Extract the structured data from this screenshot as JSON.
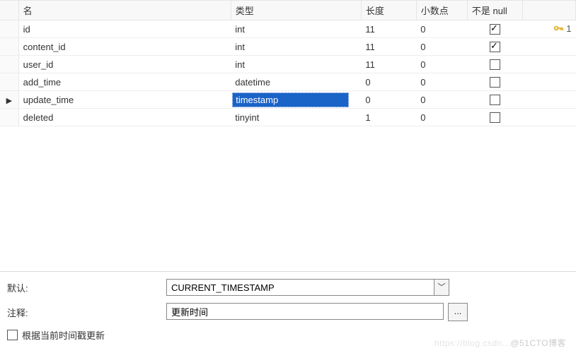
{
  "columns": {
    "name": "名",
    "type": "类型",
    "length": "长度",
    "decimals": "小数点",
    "not_null": "不是 null"
  },
  "rows": [
    {
      "name": "id",
      "type": "int",
      "length": "11",
      "decimals": "0",
      "not_null": true,
      "primary_key": true,
      "key_label": "1",
      "selected": false,
      "current": false
    },
    {
      "name": "content_id",
      "type": "int",
      "length": "11",
      "decimals": "0",
      "not_null": true,
      "primary_key": false,
      "key_label": "",
      "selected": false,
      "current": false
    },
    {
      "name": "user_id",
      "type": "int",
      "length": "11",
      "decimals": "0",
      "not_null": false,
      "primary_key": false,
      "key_label": "",
      "selected": false,
      "current": false
    },
    {
      "name": "add_time",
      "type": "datetime",
      "length": "0",
      "decimals": "0",
      "not_null": false,
      "primary_key": false,
      "key_label": "",
      "selected": false,
      "current": false
    },
    {
      "name": "update_time",
      "type": "timestamp",
      "length": "0",
      "decimals": "0",
      "not_null": false,
      "primary_key": false,
      "key_label": "",
      "selected": true,
      "current": true
    },
    {
      "name": "deleted",
      "type": "tinyint",
      "length": "1",
      "decimals": "0",
      "not_null": false,
      "primary_key": false,
      "key_label": "",
      "selected": false,
      "current": false
    }
  ],
  "details": {
    "default_label": "默认:",
    "default_value": "CURRENT_TIMESTAMP",
    "comment_label": "注释:",
    "comment_value": "更新时间",
    "on_update_label": "根据当前时间戳更新",
    "on_update_checked": false,
    "ellipsis_btn": "..."
  },
  "watermark": {
    "left": "https://blog.csdn...",
    "right": "@51CTO博客"
  }
}
